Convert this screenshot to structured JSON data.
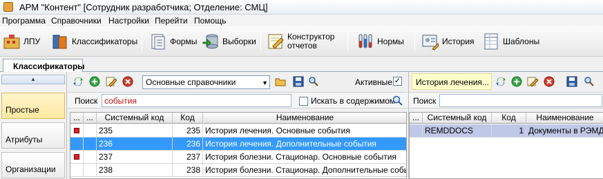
{
  "window": {
    "title": "АРМ \"Контент\" [Сотрудник разработчика; Отделение: СМЦ]"
  },
  "menu": [
    "Программа",
    "Справочники",
    "Настройки",
    "Перейти",
    "Помощь"
  ],
  "toolbar": {
    "lpu": "ЛПУ",
    "classifiers": "Классификаторы",
    "forms": "Формы",
    "selections": "Выборки",
    "constructor_line1": "Конструктор",
    "constructor_line2": "отчетов",
    "norms": "Нормы",
    "history": "История",
    "templates": "Шаблоны"
  },
  "tabs": {
    "active": "Классификаторы"
  },
  "left_nav": {
    "collapse": "▲",
    "items": [
      "Простые",
      "Атрибуты",
      "Организации"
    ]
  },
  "main": {
    "dictionary_select": "Основные справочники",
    "active_label": "Активные",
    "active_checked": "✓",
    "search_label": "Поиск",
    "search_value": "события",
    "search_in_content_label": "Искать в содержимом",
    "columns": [
      "...",
      "...",
      "Системный код",
      "Код",
      "Наименование"
    ],
    "rows": [
      {
        "flag": true,
        "syscode": "235",
        "code": "235",
        "name": "История лечения. Основные события"
      },
      {
        "flag": false,
        "syscode": "236",
        "code": "236",
        "name": "История лечения. Дополнительные события"
      },
      {
        "flag": true,
        "syscode": "237",
        "code": "237",
        "name": "История болезни. Стационар. Основные события"
      },
      {
        "flag": false,
        "syscode": "238",
        "code": "238",
        "name": "История болезни. Стационар. Дополнительные события"
      }
    ]
  },
  "right": {
    "title": "История лечения...",
    "search_label": "Поиск",
    "search_value": "",
    "columns": [
      "...",
      "Системный код",
      "Код",
      "Наименование"
    ],
    "rows": [
      {
        "syscode": "REMDDOCS",
        "code": "1",
        "name": "Документы в РЭМД"
      }
    ]
  },
  "colors": {
    "selection": "#3399ff",
    "selection_inactive": "#c0c8e8",
    "flag": "#d42424",
    "title_highlight": "#ffffcc"
  }
}
